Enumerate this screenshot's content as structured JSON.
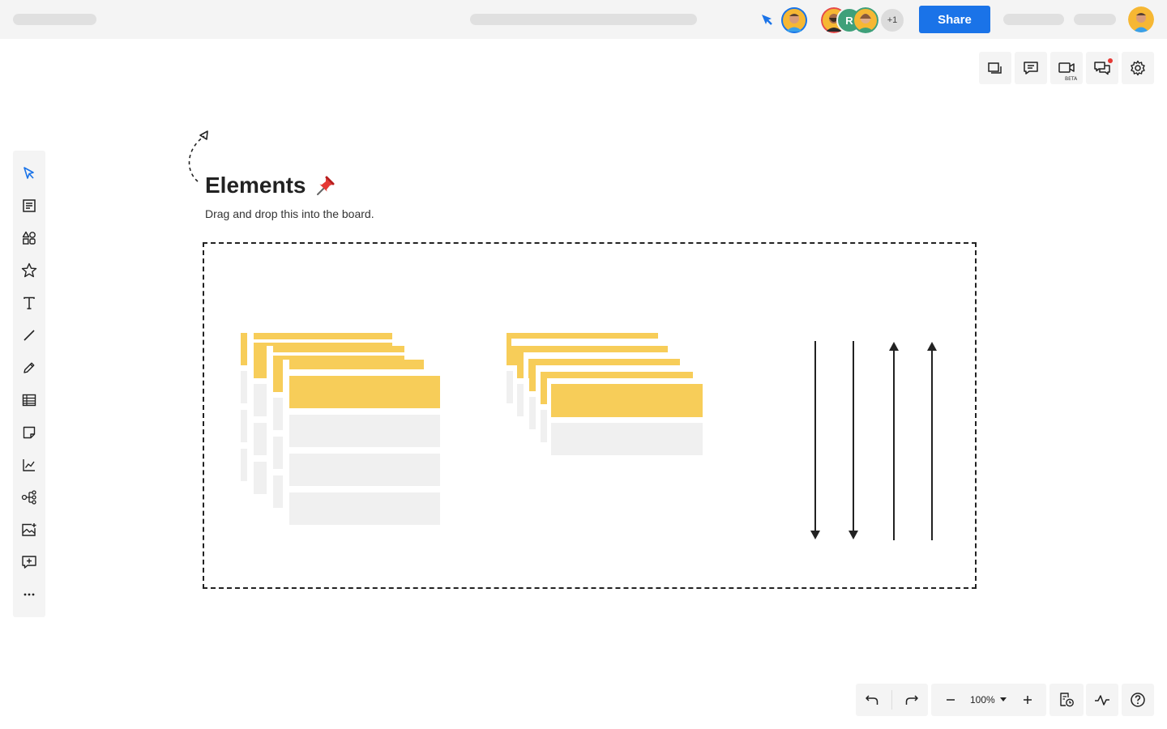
{
  "header": {
    "share_label": "Share",
    "collaborators": [
      {
        "type": "photo",
        "name": "user-photo-1"
      },
      {
        "type": "initial",
        "initial": "R",
        "color": "#3fa07a"
      },
      {
        "type": "photo",
        "name": "user-photo-2"
      }
    ],
    "extra_collaborators": "+1"
  },
  "top_right_tools": [
    {
      "icon": "layers-icon"
    },
    {
      "icon": "comment-icon"
    },
    {
      "icon": "video-icon",
      "badge": "BETA"
    },
    {
      "icon": "chat-icon",
      "notification": true
    },
    {
      "icon": "gear-icon"
    }
  ],
  "left_toolbar": [
    "select-icon",
    "template-icon",
    "shapes-icon",
    "star-icon",
    "text-icon",
    "line-icon",
    "pencil-icon",
    "table-icon",
    "sticky-note-icon",
    "chart-icon",
    "mind-map-icon",
    "image-icon",
    "add-comment-icon",
    "more-icon"
  ],
  "canvas": {
    "title": "Elements",
    "subtitle": "Drag and drop this into the board."
  },
  "bottom_toolbar": {
    "zoom": "100%"
  },
  "colors": {
    "accent": "#1a73e8",
    "sticky_yellow": "#f7cd59",
    "placeholder_gray": "#f0f0f0"
  }
}
